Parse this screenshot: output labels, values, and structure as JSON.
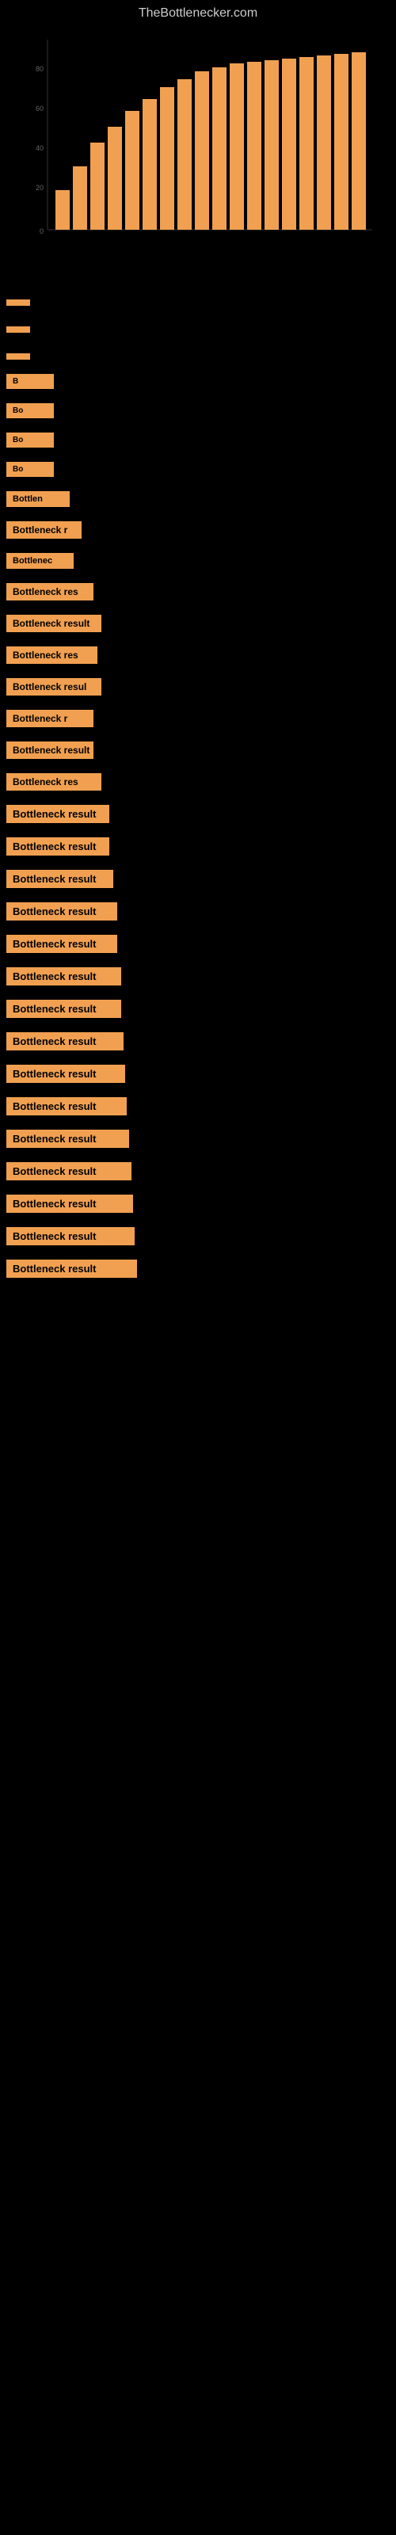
{
  "site": {
    "title": "TheBottlenecker.com"
  },
  "results": [
    {
      "label": "",
      "width_class": "bar-w1"
    },
    {
      "label": "",
      "width_class": "bar-w2"
    },
    {
      "label": "",
      "width_class": "bar-w3"
    },
    {
      "label": "B",
      "width_class": "bar-w4"
    },
    {
      "label": "Bo",
      "width_class": "bar-w4"
    },
    {
      "label": "Bo",
      "width_class": "bar-w4"
    },
    {
      "label": "Bo",
      "width_class": "bar-w4"
    },
    {
      "label": "Bottlen",
      "width_class": "bar-w5"
    },
    {
      "label": "Bottleneck r",
      "width_class": "bar-w7"
    },
    {
      "label": "Bottlenec",
      "width_class": "bar-w6"
    },
    {
      "label": "Bottleneck res",
      "width_class": "bar-w8"
    },
    {
      "label": "Bottleneck result",
      "width_class": "bar-w10"
    },
    {
      "label": "Bottleneck res",
      "width_class": "bar-w9"
    },
    {
      "label": "Bottleneck resul",
      "width_class": "bar-w10"
    },
    {
      "label": "Bottleneck r",
      "width_class": "bar-w8"
    },
    {
      "label": "Bottleneck result",
      "width_class": "bar-w11"
    },
    {
      "label": "Bottleneck res",
      "width_class": "bar-w10"
    },
    {
      "label": "Bottleneck result",
      "width_class": "bar-w14"
    },
    {
      "label": "Bottleneck result",
      "width_class": "bar-w14"
    },
    {
      "label": "Bottleneck result",
      "width_class": "bar-w15"
    },
    {
      "label": "Bottleneck result",
      "width_class": "bar-w16"
    },
    {
      "label": "Bottleneck result",
      "width_class": "bar-w16"
    },
    {
      "label": "Bottleneck result",
      "width_class": "bar-w17"
    },
    {
      "label": "Bottleneck result",
      "width_class": "bar-w17"
    },
    {
      "label": "Bottleneck result",
      "width_class": "bar-w18"
    },
    {
      "label": "Bottleneck result",
      "width_class": "bar-w19"
    },
    {
      "label": "Bottleneck result",
      "width_class": "bar-w20"
    },
    {
      "label": "Bottleneck result",
      "width_class": "bar-w21"
    },
    {
      "label": "Bottleneck result",
      "width_class": "bar-w22"
    },
    {
      "label": "Bottleneck result",
      "width_class": "bar-w23"
    },
    {
      "label": "Bottleneck result",
      "width_class": "bar-w24"
    },
    {
      "label": "Bottleneck result",
      "width_class": "bar-w25"
    }
  ],
  "colors": {
    "background": "#000000",
    "bar": "#f0a050",
    "text": "#cccccc"
  }
}
